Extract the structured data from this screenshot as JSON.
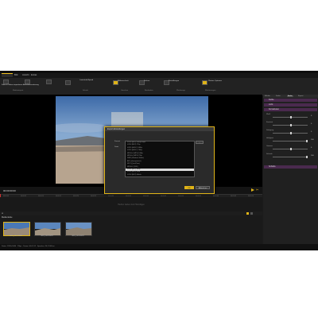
{
  "tabs": [
    "",
    "Bild",
    "Ansicht",
    "Extras"
  ],
  "ribbon": {
    "groups": [
      "Medienimport",
      "Schnitt",
      "Vorschau",
      "Bearbeiten",
      "Werkzeuge",
      "Markierungen"
    ],
    "buttons": [
      "Fotos & Videos importieren",
      "Aufnahmesortierung",
      "Lautstärke/Speed",
      "Bildausschnitt",
      "Drehen",
      "Einstellungen",
      "Weitere Optionen"
    ]
  },
  "timecode": "00:00:00:00",
  "timeline": {
    "ticks": [
      "00:00:00",
      "00:00:05",
      "00:00:10",
      "00:00:15",
      "00:00:20",
      "00:00:25",
      "00:00:30",
      "00:00:35",
      "00:00:40",
      "00:00:45",
      "00:00:50",
      "00:00:55",
      "00:01:00",
      "00:01:05",
      "00:01:10"
    ],
    "hint": "Hierher ziehen zum Hinzufügen"
  },
  "media": {
    "title": "Medienleiste",
    "thumbs": [
      "IMG_0001.MP4",
      "IMG_0002.MP4",
      "IMG_0003.MP4"
    ]
  },
  "right_panel": {
    "tabs": [
      "Effekte",
      "Farbe",
      "Audio",
      "Export"
    ],
    "sections": [
      "Farbe",
      "Licht",
      "Korrekturen",
      "Schärfe"
    ],
    "rows": [
      {
        "label": "Weiß",
        "value": "0"
      },
      {
        "label": "Kontrast",
        "value": "0"
      },
      {
        "label": "Sättigung",
        "value": "0"
      },
      {
        "label": "Helligkeit",
        "value": "100"
      },
      {
        "label": "Gamma",
        "value": "0"
      },
      {
        "label": "Schärfe",
        "value": "100"
      }
    ]
  },
  "dialog": {
    "title": "Export-Einstellungen",
    "label_format": "Format",
    "label_file": "Datei",
    "items": [
      "H.264 (MP4) 1080p 30fps",
      "H.264 (MP4) 720p",
      "H.265 (HEVC) 1080p",
      "H.265 (HEVC) 2160p",
      "MPEG-4 (MP4) 1080p",
      "MPEG-4 (MP4) 720p",
      "WMV (Windows Media)",
      "AVI (unkomprimiert)",
      "MOV (QuickTime)",
      "MPEG-2 (DVD)",
      "H.264 (MP4) 480p",
      "H.264 (MP4) Web",
      "H.264 (MP4) Mobile"
    ],
    "selected_index": 10,
    "ok": "OK",
    "cancel": "Abbrechen"
  },
  "status": "Daten: 1920×1080 · 25fps · Dauer: 00:01:12 · Speicher: 34,2 GB frei",
  "colors": {
    "accent": "#e0b418",
    "section": "#4a2a4e"
  }
}
